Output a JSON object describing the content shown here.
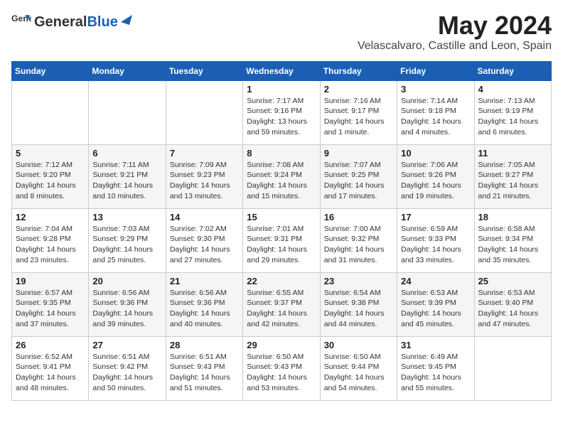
{
  "logo": {
    "text_general": "General",
    "text_blue": "Blue"
  },
  "title": {
    "month_year": "May 2024",
    "location": "Velascalvaro, Castille and Leon, Spain"
  },
  "headers": [
    "Sunday",
    "Monday",
    "Tuesday",
    "Wednesday",
    "Thursday",
    "Friday",
    "Saturday"
  ],
  "weeks": [
    [
      {
        "day": "",
        "content": ""
      },
      {
        "day": "",
        "content": ""
      },
      {
        "day": "",
        "content": ""
      },
      {
        "day": "1",
        "content": "Sunrise: 7:17 AM\nSunset: 9:16 PM\nDaylight: 13 hours\nand 59 minutes."
      },
      {
        "day": "2",
        "content": "Sunrise: 7:16 AM\nSunset: 9:17 PM\nDaylight: 14 hours\nand 1 minute."
      },
      {
        "day": "3",
        "content": "Sunrise: 7:14 AM\nSunset: 9:18 PM\nDaylight: 14 hours\nand 4 minutes."
      },
      {
        "day": "4",
        "content": "Sunrise: 7:13 AM\nSunset: 9:19 PM\nDaylight: 14 hours\nand 6 minutes."
      }
    ],
    [
      {
        "day": "5",
        "content": "Sunrise: 7:12 AM\nSunset: 9:20 PM\nDaylight: 14 hours\nand 8 minutes."
      },
      {
        "day": "6",
        "content": "Sunrise: 7:11 AM\nSunset: 9:21 PM\nDaylight: 14 hours\nand 10 minutes."
      },
      {
        "day": "7",
        "content": "Sunrise: 7:09 AM\nSunset: 9:23 PM\nDaylight: 14 hours\nand 13 minutes."
      },
      {
        "day": "8",
        "content": "Sunrise: 7:08 AM\nSunset: 9:24 PM\nDaylight: 14 hours\nand 15 minutes."
      },
      {
        "day": "9",
        "content": "Sunrise: 7:07 AM\nSunset: 9:25 PM\nDaylight: 14 hours\nand 17 minutes."
      },
      {
        "day": "10",
        "content": "Sunrise: 7:06 AM\nSunset: 9:26 PM\nDaylight: 14 hours\nand 19 minutes."
      },
      {
        "day": "11",
        "content": "Sunrise: 7:05 AM\nSunset: 9:27 PM\nDaylight: 14 hours\nand 21 minutes."
      }
    ],
    [
      {
        "day": "12",
        "content": "Sunrise: 7:04 AM\nSunset: 9:28 PM\nDaylight: 14 hours\nand 23 minutes."
      },
      {
        "day": "13",
        "content": "Sunrise: 7:03 AM\nSunset: 9:29 PM\nDaylight: 14 hours\nand 25 minutes."
      },
      {
        "day": "14",
        "content": "Sunrise: 7:02 AM\nSunset: 9:30 PM\nDaylight: 14 hours\nand 27 minutes."
      },
      {
        "day": "15",
        "content": "Sunrise: 7:01 AM\nSunset: 9:31 PM\nDaylight: 14 hours\nand 29 minutes."
      },
      {
        "day": "16",
        "content": "Sunrise: 7:00 AM\nSunset: 9:32 PM\nDaylight: 14 hours\nand 31 minutes."
      },
      {
        "day": "17",
        "content": "Sunrise: 6:59 AM\nSunset: 9:33 PM\nDaylight: 14 hours\nand 33 minutes."
      },
      {
        "day": "18",
        "content": "Sunrise: 6:58 AM\nSunset: 9:34 PM\nDaylight: 14 hours\nand 35 minutes."
      }
    ],
    [
      {
        "day": "19",
        "content": "Sunrise: 6:57 AM\nSunset: 9:35 PM\nDaylight: 14 hours\nand 37 minutes."
      },
      {
        "day": "20",
        "content": "Sunrise: 6:56 AM\nSunset: 9:36 PM\nDaylight: 14 hours\nand 39 minutes."
      },
      {
        "day": "21",
        "content": "Sunrise: 6:56 AM\nSunset: 9:36 PM\nDaylight: 14 hours\nand 40 minutes."
      },
      {
        "day": "22",
        "content": "Sunrise: 6:55 AM\nSunset: 9:37 PM\nDaylight: 14 hours\nand 42 minutes."
      },
      {
        "day": "23",
        "content": "Sunrise: 6:54 AM\nSunset: 9:38 PM\nDaylight: 14 hours\nand 44 minutes."
      },
      {
        "day": "24",
        "content": "Sunrise: 6:53 AM\nSunset: 9:39 PM\nDaylight: 14 hours\nand 45 minutes."
      },
      {
        "day": "25",
        "content": "Sunrise: 6:53 AM\nSunset: 9:40 PM\nDaylight: 14 hours\nand 47 minutes."
      }
    ],
    [
      {
        "day": "26",
        "content": "Sunrise: 6:52 AM\nSunset: 9:41 PM\nDaylight: 14 hours\nand 48 minutes."
      },
      {
        "day": "27",
        "content": "Sunrise: 6:51 AM\nSunset: 9:42 PM\nDaylight: 14 hours\nand 50 minutes."
      },
      {
        "day": "28",
        "content": "Sunrise: 6:51 AM\nSunset: 9:43 PM\nDaylight: 14 hours\nand 51 minutes."
      },
      {
        "day": "29",
        "content": "Sunrise: 6:50 AM\nSunset: 9:43 PM\nDaylight: 14 hours\nand 53 minutes."
      },
      {
        "day": "30",
        "content": "Sunrise: 6:50 AM\nSunset: 9:44 PM\nDaylight: 14 hours\nand 54 minutes."
      },
      {
        "day": "31",
        "content": "Sunrise: 6:49 AM\nSunset: 9:45 PM\nDaylight: 14 hours\nand 55 minutes."
      },
      {
        "day": "",
        "content": ""
      }
    ]
  ]
}
